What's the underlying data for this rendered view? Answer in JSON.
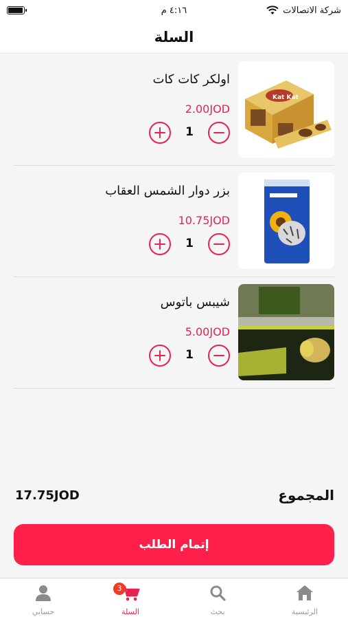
{
  "status_bar": {
    "carrier": "شركة الاتصالات",
    "time": "٤:١٦ م"
  },
  "header": {
    "title": "السلة"
  },
  "cart": {
    "items": [
      {
        "name": "اولكر كات كات",
        "price": "2.00JOD",
        "quantity": "1",
        "image": "kat-kat-box"
      },
      {
        "name": "بزر دوار الشمس العقاب",
        "price": "10.75JOD",
        "quantity": "1",
        "image": "sunflower-seeds-bag"
      },
      {
        "name": "شيبس باتوس",
        "price": "5.00JOD",
        "quantity": "1",
        "image": "patos-chips-box"
      }
    ]
  },
  "summary": {
    "total_label": "المجموع",
    "total_value": "17.75JOD"
  },
  "checkout": {
    "label": "إتمام الطلب"
  },
  "nav": {
    "items": [
      {
        "label": "الرئيسية",
        "icon": "home-icon"
      },
      {
        "label": "بحث",
        "icon": "search-icon"
      },
      {
        "label": "السلة",
        "icon": "cart-icon",
        "badge": "3",
        "active": true
      },
      {
        "label": "حسابي",
        "icon": "user-icon"
      }
    ]
  },
  "colors": {
    "accent": "#e8224f",
    "button": "#ff1f4b",
    "badge": "#ef3b24"
  }
}
